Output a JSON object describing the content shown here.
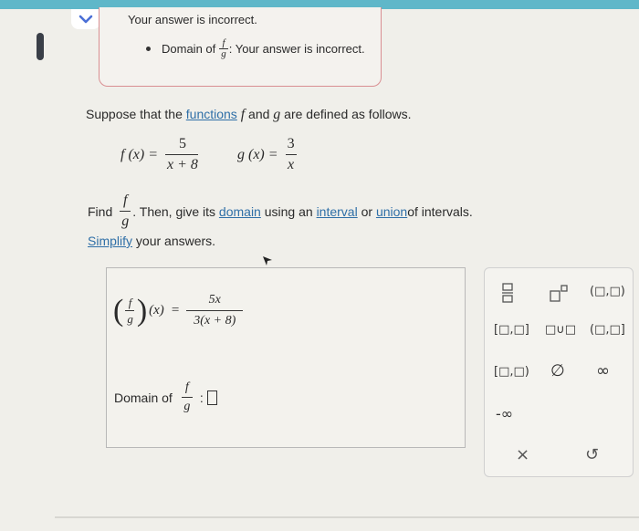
{
  "feedback": {
    "title": "Your answer is incorrect.",
    "bullet_prefix": "Domain of",
    "frac_num": "f",
    "frac_den": "g",
    "bullet_suffix": ": Your answer is incorrect."
  },
  "problem": {
    "intro_1": "Suppose that the ",
    "functions_link": "functions",
    "intro_2": " and ",
    "intro_3": " are defined as follows.",
    "f_var": "f",
    "g_var": "g",
    "f_lhs": "f (x) =",
    "f_num": "5",
    "f_den": "x + 8",
    "g_lhs": "g (x) =",
    "g_num": "3",
    "g_den": "x",
    "find": "Find",
    "find_num": "f",
    "find_den": "g",
    "find_mid": ". Then, give its ",
    "domain_link": "domain",
    "using": " using an ",
    "interval_link": "interval",
    "or": " or ",
    "union_link": "union",
    "of_intervals": " of intervals.",
    "simplify_link": "Simplify",
    "simplify_rest": " your answers."
  },
  "answer": {
    "lhs_num": "f",
    "lhs_den": "g",
    "lhs_arg": "(x)",
    "equals": "=",
    "rhs_num": "5x",
    "rhs_den": "3(x + 8)",
    "domain_label": "Domain of",
    "dom_num": "f",
    "dom_den": "g",
    "colon": ":"
  },
  "palette": {
    "closed_closed": "[□,□]",
    "union": "□∪□",
    "open_closed": "(□,□]",
    "closed_open": "[□,□)",
    "empty_set": "∅",
    "infinity": "∞",
    "neg_infinity": "-∞",
    "clear": "×",
    "undo": "↺",
    "open_open": "(□,□)"
  }
}
